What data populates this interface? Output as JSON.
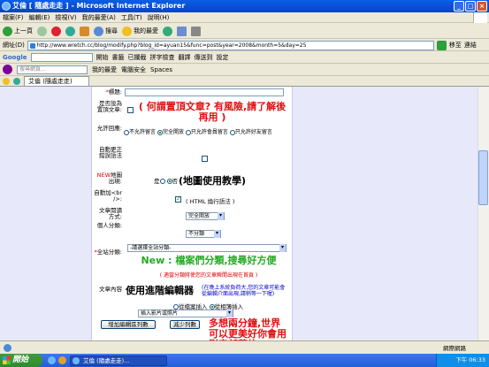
{
  "window": {
    "title": "艾倫 [ 隨處走走 ] - Microsoft Internet Explorer",
    "buttons": [
      "_",
      "□",
      "×"
    ]
  },
  "menu": [
    "檔案(F)",
    "編輯(E)",
    "檢視(V)",
    "我的最愛(A)",
    "工具(T)",
    "說明(H)"
  ],
  "toolbar": {
    "back": "上一頁",
    "search": "搜尋",
    "favorites": "我的最愛"
  },
  "address": {
    "label": "網址(D)",
    "url": "http://www.wretch.cc/blog/modify.php?blog_id=ayuan15&func=post&year=2008&month=5&day=25",
    "go": "移至",
    "links": "連結"
  },
  "google": {
    "label": "Google",
    "go": "開始",
    "items": [
      "書籤",
      "已攔截",
      "拼字檢查",
      "翻譯",
      "傳送到",
      "設定"
    ]
  },
  "yahoo": {
    "placeholder": "搜尋網頁...",
    "items": [
      "我的最愛",
      "電腦安全",
      "Spaces"
    ]
  },
  "tab": {
    "label": "艾倫 (隨處走走)"
  },
  "form": {
    "title_label": "標題:",
    "pin_label": "是否設為置頂文章:",
    "pin_note": "( 何謂置頂文章? 有風險,請了解後再用 )",
    "reply_label": "允許回應:",
    "reply_options": [
      "不允許留言",
      "完全開放",
      "只允許會員留言",
      "只允許好友留言"
    ],
    "correct_label": "自動更正錯誤語法",
    "map_label": "地圖出現:",
    "map_new": "NEW",
    "map_options": [
      "是",
      "否"
    ],
    "map_note": "(地圖使用教學)",
    "br_label": "自動加<br />:",
    "html_note": "( HTML 換行語法 )",
    "visibility_label": "文章閱讀方式:",
    "visibility_value": "完全開放",
    "personal_label": "個人分類:",
    "personal_value": "不分類",
    "site_cat_label": "全站分類:",
    "site_cat_value": "-請選擇全站分類-",
    "site_cat_new": "New : 檔案們分類,搜尋好方便",
    "site_cat_hint": "( 適當分類將使您的文章瞬間出現在首頁 )",
    "editor_label": "文章內容",
    "editor_title": "使用進階編輯器",
    "editor_hint": "(在晚上系統負荷大,您的文章可能會從編輯介面出現,請稍等一下喔)",
    "insert_options": [
      "從檔案插入",
      "從相簿插入"
    ],
    "media_value": "插入影片或照片",
    "btn_add_rows": "增加編輯區列數",
    "btn_reduce_rows": "減少列數",
    "bottom_note": "多想兩分鐘,世界可以更美好你會用影音部落格"
  },
  "status": {
    "text": "",
    "zone": "網際網路"
  },
  "taskbar": {
    "start": "開始",
    "task": "艾倫 (隨處走走)...",
    "clock": "下午 06:33"
  }
}
